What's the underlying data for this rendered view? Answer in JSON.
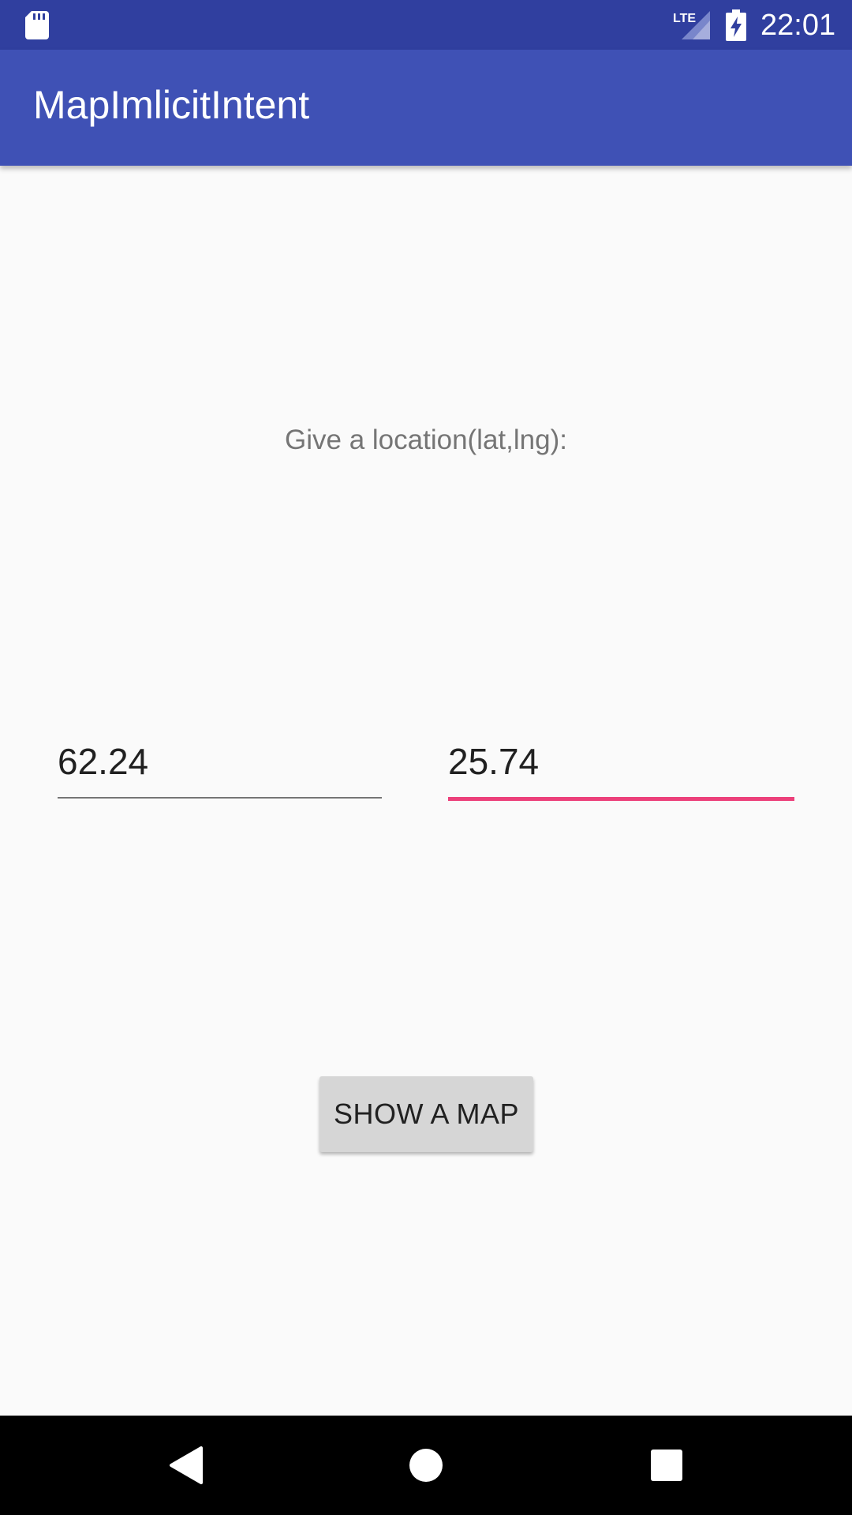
{
  "status_bar": {
    "time": "22:01",
    "network": "LTE",
    "icons": [
      "sd-card-icon",
      "lte-signal-icon",
      "battery-charging-icon"
    ]
  },
  "app_bar": {
    "title": "MapImlicitIntent"
  },
  "main": {
    "prompt": "Give a location(lat,lng):",
    "latitude_value": "62.24",
    "longitude_value": "25.74",
    "show_map_label": "SHOW A MAP"
  },
  "nav_bar": {
    "icons": [
      "back-icon",
      "home-icon",
      "recents-icon"
    ]
  },
  "colors": {
    "status_bar": "#303f9f",
    "app_bar": "#3f51b5",
    "accent": "#ec407a",
    "background": "#fafafa"
  }
}
